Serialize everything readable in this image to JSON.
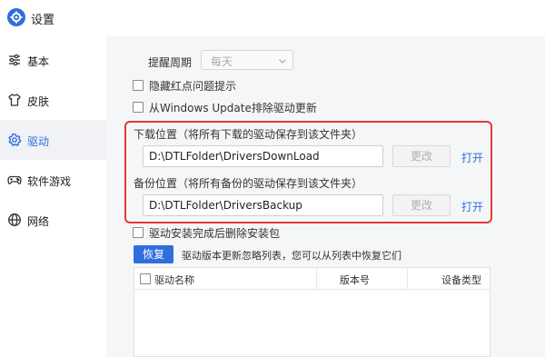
{
  "window": {
    "title": "设置"
  },
  "sidebar": {
    "items": [
      {
        "label": "基本",
        "icon": "sliders-icon",
        "active": false
      },
      {
        "label": "皮肤",
        "icon": "tshirt-icon",
        "active": false
      },
      {
        "label": "驱动",
        "icon": "gear-icon",
        "active": true
      },
      {
        "label": "软件游戏",
        "icon": "gamepad-icon",
        "active": false
      },
      {
        "label": "网络",
        "icon": "globe-icon",
        "active": false
      }
    ]
  },
  "settings": {
    "remind_period_label": "提醒周期",
    "remind_period_value": "每天",
    "hide_red_dot_label": "隐藏红点问题提示",
    "hide_red_dot_checked": false,
    "exclude_windows_update_label": "从Windows  Update排除驱动更新",
    "exclude_windows_update_checked": false
  },
  "download": {
    "label": "下载位置（将所有下载的驱动保存到该文件夹）",
    "path": "D:\\DTLFolder\\DriversDownLoad",
    "change_label": "更改",
    "open_label": "打开"
  },
  "backup": {
    "label": "备份位置（将所有备份的驱动保存到该文件夹）",
    "path": "D:\\DTLFolder\\DriversBackup",
    "change_label": "更改",
    "open_label": "打开"
  },
  "delete_after_install": {
    "label": "驱动安装完成后删除安装包",
    "checked": false
  },
  "restore": {
    "button_label": "恢复",
    "note": "驱动版本更新忽略列表，您可以从列表中恢复它们"
  },
  "table": {
    "columns": [
      "驱动名称",
      "版本号",
      "设备类型"
    ],
    "rows": []
  },
  "colors": {
    "accent": "#2f6fdc",
    "highlight_frame": "#e03a3a",
    "content_bg": "#f5f6f8"
  }
}
